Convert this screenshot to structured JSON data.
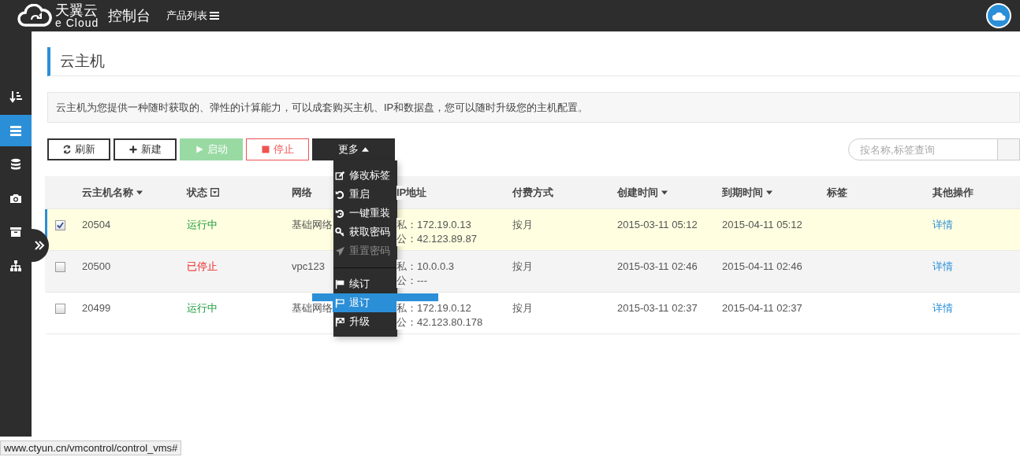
{
  "topbar": {
    "brand": "天翼云",
    "brand_sub": "e Cloud",
    "console": "控制台",
    "products": "产品列表"
  },
  "sidebar": {
    "items": [
      {
        "kind": "sort",
        "selected": false
      },
      {
        "kind": "list",
        "selected": true
      },
      {
        "kind": "database",
        "selected": false
      },
      {
        "kind": "camera",
        "selected": false
      },
      {
        "kind": "archive",
        "selected": false
      },
      {
        "kind": "sitemap",
        "selected": false
      }
    ]
  },
  "page": {
    "title": "云主机",
    "description": "云主机为您提供一种随时获取的、弹性的计算能力，可以成套购买主机、IP和数据盘，您可以随时升级您的主机配置。"
  },
  "toolbar": {
    "buttons": [
      {
        "kind": "refresh",
        "label": "刷新",
        "disabled": false
      },
      {
        "kind": "new",
        "label": "新建",
        "disabled": false
      },
      {
        "kind": "start",
        "label": "启动",
        "disabled": true
      },
      {
        "kind": "stop",
        "label": "停止",
        "disabled": false
      },
      {
        "kind": "more",
        "label": "更多",
        "disabled": false,
        "expanded": true
      }
    ],
    "search": {
      "placeholder": "按名称,标签查询"
    }
  },
  "menu": {
    "groups": [
      [
        {
          "kind": "edit",
          "label": "修改标签",
          "disabled": false,
          "selected": false
        },
        {
          "kind": "restart",
          "label": "重启",
          "disabled": false,
          "selected": false
        },
        {
          "kind": "reinstall",
          "label": "一键重装",
          "disabled": false,
          "selected": false
        },
        {
          "kind": "key",
          "label": "获取密码",
          "disabled": false,
          "selected": false
        },
        {
          "kind": "send",
          "label": "重置密码",
          "disabled": true,
          "selected": false
        }
      ],
      [
        {
          "kind": "flag",
          "label": "续订",
          "disabled": false,
          "selected": false
        },
        {
          "kind": "flag-outline",
          "label": "退订",
          "disabled": false,
          "selected": true
        },
        {
          "kind": "flag-checkered",
          "label": "升级",
          "disabled": false,
          "selected": false
        }
      ]
    ]
  },
  "table": {
    "columns": [
      {
        "label": "云主机名称",
        "kind": "sort"
      },
      {
        "label": "状态",
        "kind": "filter"
      },
      {
        "label": "网络",
        "kind": "plain"
      },
      {
        "label": "IP地址",
        "kind": "plain"
      },
      {
        "label": "付费方式",
        "kind": "plain"
      },
      {
        "label": "创建时间",
        "kind": "sort"
      },
      {
        "label": "到期时间",
        "kind": "sort"
      },
      {
        "label": "标签",
        "kind": "plain"
      },
      {
        "label": "其他操作",
        "kind": "plain"
      }
    ],
    "rows": [
      {
        "checked": true,
        "selected": true,
        "name": "20504",
        "status": "运行中",
        "kind": "running",
        "network": "基础网络",
        "ip_private": "私：172.19.0.13",
        "ip_public": "公：42.123.89.87",
        "billing": "按月",
        "created": "2015-03-11 05:12",
        "expires": "2015-04-11 05:12",
        "action": "详情"
      },
      {
        "checked": false,
        "selected": false,
        "name": "20500",
        "status": "已停止",
        "kind": "stopped",
        "network": "vpc123",
        "ip_private": "私：10.0.0.3",
        "ip_public": "公：---",
        "billing": "按月",
        "created": "2015-03-11 02:46",
        "expires": "2015-04-11 02:46",
        "action": "详情"
      },
      {
        "checked": false,
        "selected": false,
        "name": "20499",
        "status": "运行中",
        "kind": "running",
        "network": "基础网络",
        "ip_private": "私：172.19.0.12",
        "ip_public": "公：42.123.80.178",
        "billing": "按月",
        "created": "2015-03-11 02:37",
        "expires": "2015-04-11 02:37",
        "action": "详情"
      }
    ]
  },
  "status_bar": {
    "url": "www.ctyun.cn/vmcontrol/control_vms#"
  }
}
